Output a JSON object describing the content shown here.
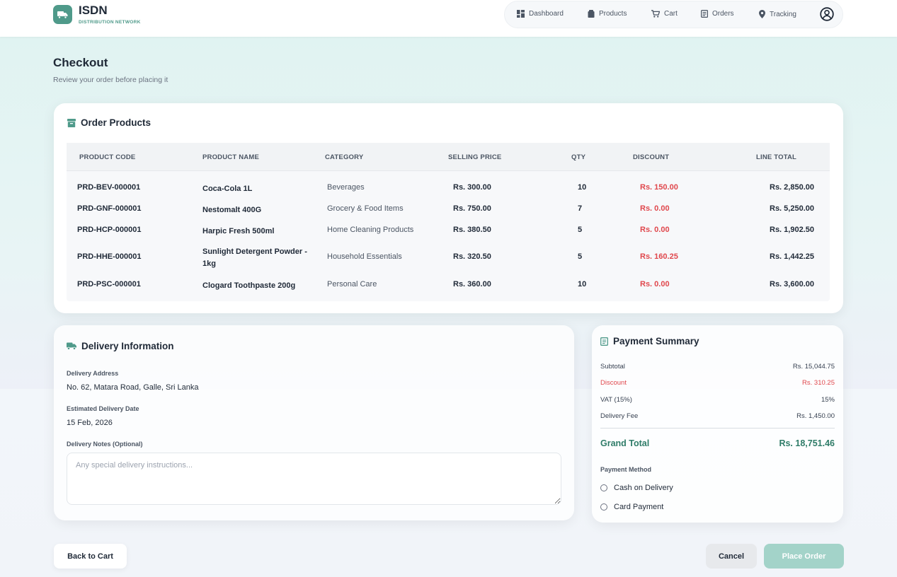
{
  "colors": {
    "brand": "#4f9a8a",
    "accent": "#2f7c68",
    "danger": "#e0474c",
    "place_order_bg": "#a3d3c9"
  },
  "header": {
    "brand_name": "ISDN",
    "brand_sub": "DISTRIBUTION NETWORK",
    "nav": [
      {
        "label": "Dashboard",
        "icon": "dashboard-icon"
      },
      {
        "label": "Products",
        "icon": "box-icon"
      },
      {
        "label": "Cart",
        "icon": "cart-icon"
      },
      {
        "label": "Orders",
        "icon": "orders-icon"
      },
      {
        "label": "Tracking",
        "icon": "location-pin-icon"
      }
    ],
    "avatar_icon": "user-circle-icon"
  },
  "page": {
    "title": "Checkout",
    "subtitle": "Review your order before placing it"
  },
  "products": {
    "title": "Order Products",
    "columns": [
      "PRODUCT CODE",
      "PRODUCT NAME",
      "CATEGORY",
      "SELLING PRICE",
      "QTY",
      "DISCOUNT",
      "LINE TOTAL"
    ],
    "rows": [
      {
        "code": "PRD-BEV-000001",
        "name": "Coca-Cola 1L",
        "category": "Beverages",
        "price": "Rs. 300.00",
        "qty": "10",
        "discount": "Rs. 150.00",
        "total": "Rs. 2,850.00"
      },
      {
        "code": "PRD-GNF-000001",
        "name": "Nestomalt 400G",
        "category": "Grocery & Food Items",
        "price": "Rs. 750.00",
        "qty": "7",
        "discount": "Rs. 0.00",
        "total": "Rs. 5,250.00"
      },
      {
        "code": "PRD-HCP-000001",
        "name": "Harpic Fresh 500ml",
        "category": "Home Cleaning Products",
        "price": "Rs. 380.50",
        "qty": "5",
        "discount": "Rs. 0.00",
        "total": "Rs. 1,902.50"
      },
      {
        "code": "PRD-HHE-000001",
        "name": "Sunlight Detergent Powder - 1kg",
        "category": "Household Essentials",
        "price": "Rs. 320.50",
        "qty": "5",
        "discount": "Rs. 160.25",
        "total": "Rs. 1,442.25"
      },
      {
        "code": "PRD-PSC-000001",
        "name": "Clogard Toothpaste 200g",
        "category": "Personal Care",
        "price": "Rs. 360.00",
        "qty": "10",
        "discount": "Rs. 0.00",
        "total": "Rs. 3,600.00"
      }
    ]
  },
  "delivery": {
    "title": "Delivery Information",
    "address_label": "Delivery Address",
    "address": "No. 62, Matara Road, Galle, Sri Lanka",
    "date_label": "Estimated Delivery Date",
    "date": "15 Feb, 2026",
    "notes_label": "Delivery Notes (Optional)",
    "notes_placeholder": "Any special delivery instructions...",
    "notes_value": ""
  },
  "summary": {
    "title": "Payment Summary",
    "subtotal_label": "Subtotal",
    "subtotal": "Rs. 15,044.75",
    "discount_label": "Discount",
    "discount": "Rs. 310.25",
    "vat_label": "VAT (15%)",
    "vat": "15%",
    "delivery_label": "Delivery Fee",
    "delivery": "Rs. 1,450.00",
    "grand_label": "Grand Total",
    "grand": "Rs. 18,751.46",
    "method_label": "Payment Method",
    "methods": [
      "Cash on Delivery",
      "Card Payment"
    ]
  },
  "footer": {
    "back_label": "Back to Cart",
    "cancel_label": "Cancel",
    "place_label": "Place Order"
  }
}
